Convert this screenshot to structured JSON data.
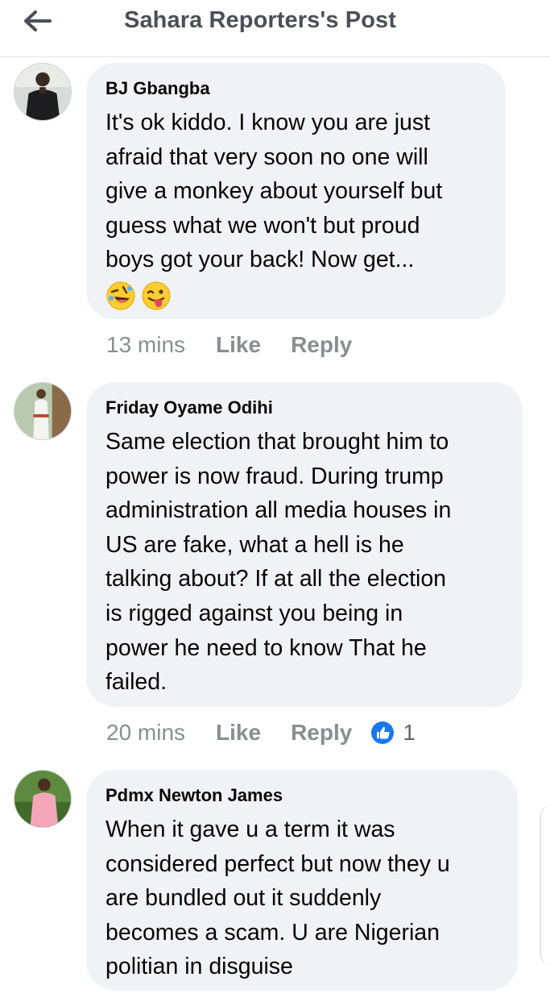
{
  "header": {
    "title": "Sahara Reporters's Post"
  },
  "comments": [
    {
      "author": "BJ Gbangba",
      "text": "It's ok kiddo. I know you are just\nafraid that very soon no one will\ngive a monkey about yourself but\nguess what we won't but proud\nboys got your back! Now get...",
      "emojis": [
        "rolling-on-floor-laughing",
        "winking-face-with-tongue"
      ],
      "time": "13 mins",
      "like_label": "Like",
      "reply_label": "Reply"
    },
    {
      "author": "Friday Oyame Odihi",
      "text": "Same election that brought him to\npower is now fraud. During trump\nadministration all media houses in\nUS are fake, what a hell is he\ntalking about?  If at all the election\nis rigged against you being in\npower he need to know That he\nfailed.",
      "time": "20 mins",
      "like_label": "Like",
      "reply_label": "Reply",
      "reaction_icon": "thumbs-up-icon",
      "reaction_count": "1"
    },
    {
      "author": "Pdmx Newton James",
      "text": "When it gave u a term it was\nconsidered perfect but now they u\nare bundled out it suddenly\nbecomes a scam. U are Nigerian\npolitian in disguise"
    }
  ],
  "colors": {
    "bubble": "#f0f2f5",
    "muted": "#8a8d91",
    "header_text": "#4b4f56",
    "like_blue": "#1877f2"
  }
}
